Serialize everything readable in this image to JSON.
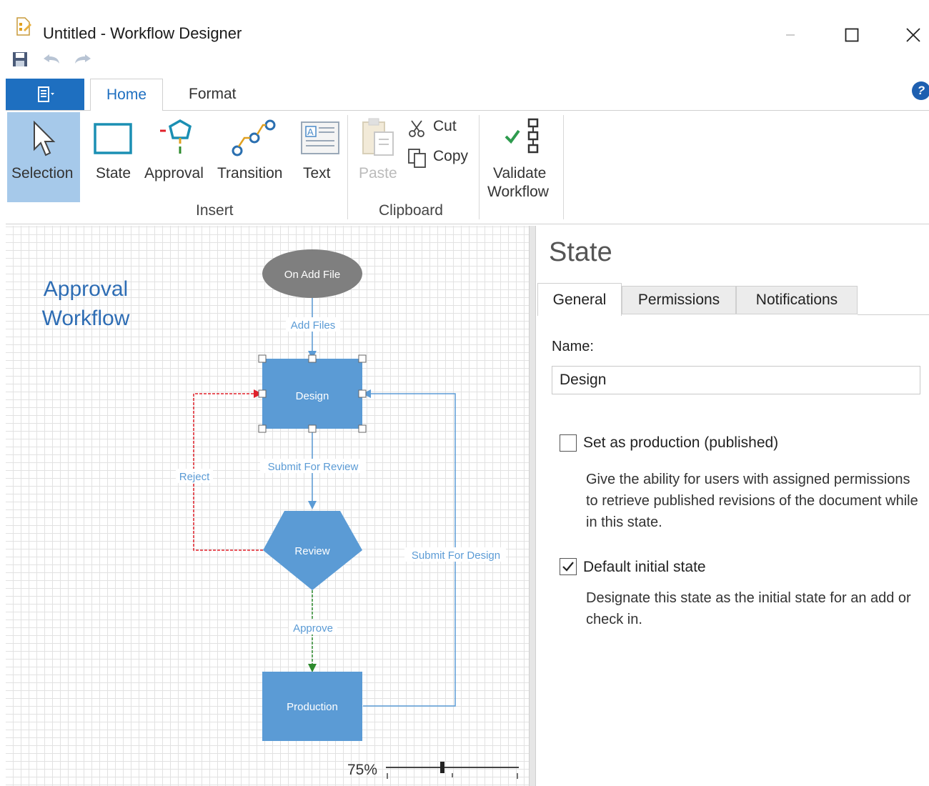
{
  "window": {
    "title": "Untitled - Workflow Designer",
    "minimize_glyph": "—",
    "maximize_glyph": "☐",
    "close_glyph": "✕"
  },
  "qat": {
    "icons": [
      "save-icon",
      "undo-icon",
      "redo-icon"
    ]
  },
  "ribbon": {
    "tabs": [
      {
        "label": "Home",
        "active": true
      },
      {
        "label": "Format",
        "active": false
      }
    ],
    "help_glyph": "?",
    "insert": {
      "group_label": "Insert",
      "buttons": [
        "Selection",
        "State",
        "Approval",
        "Transition",
        "Text"
      ]
    },
    "clipboard": {
      "group_label": "Clipboard",
      "paste": "Paste",
      "cut": "Cut",
      "copy": "Copy"
    },
    "validate": {
      "line1": "Validate",
      "line2": "Workflow"
    }
  },
  "canvas": {
    "title_line1": "Approval",
    "title_line2": "Workflow",
    "nodes": {
      "start": "On Add File",
      "design": "Design",
      "review": "Review",
      "production": "Production"
    },
    "transitions": {
      "add_files": "Add Files",
      "submit_for_review": "Submit For Review",
      "reject": "Reject",
      "submit_for_design": "Submit For Design",
      "approve": "Approve"
    },
    "zoom": "75%",
    "colors": {
      "node_fill": "#5b9bd5",
      "start_fill": "#7f7f7f",
      "link": "#5b9bd5",
      "reject": "#e0202a",
      "approve": "#2e8b2e"
    }
  },
  "panel": {
    "title": "State",
    "tabs": [
      "General",
      "Permissions",
      "Notifications"
    ],
    "name_label": "Name:",
    "name_value": "Design",
    "production": {
      "label": "Set as production (published)",
      "checked": false,
      "description": "Give the ability for users with assigned permissions to retrieve published revisions of the document while in this state."
    },
    "default_state": {
      "label": "Default initial state",
      "checked": true,
      "description": "Designate this state as the initial state for an add or check in."
    }
  }
}
